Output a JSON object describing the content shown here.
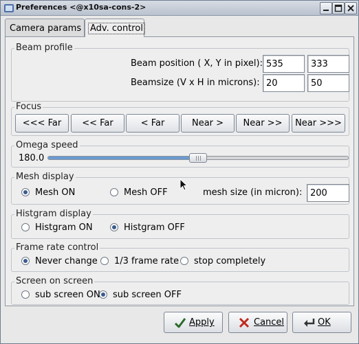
{
  "window": {
    "title": "Preferences <@x10sa-cons-2>"
  },
  "tabs": [
    {
      "label": "Camera params",
      "active": false
    },
    {
      "label": "Adv. control",
      "active": true
    }
  ],
  "beam_profile": {
    "title": "Beam profile",
    "position_label": "Beam position ( X, Y in pixel):",
    "position_x": "535",
    "position_y": "333",
    "size_label": "Beamsize (V x H in microns):",
    "size_v": "20",
    "size_h": "50"
  },
  "focus": {
    "title": "Focus",
    "buttons": [
      "<<< Far",
      "<< Far",
      "< Far",
      "Near >",
      "Near >>",
      "Near >>>"
    ]
  },
  "omega_speed": {
    "title": "Omega speed",
    "value_text": "180.0",
    "slider_fraction": 0.5
  },
  "mesh_display": {
    "title": "Mesh display",
    "on_label": "Mesh ON",
    "off_label": "Mesh OFF",
    "selected": "on",
    "size_label": "mesh size (in micron):",
    "size_value": "200"
  },
  "histogram_display": {
    "title": "Histgram display",
    "on_label": "Histgram ON",
    "off_label": "Histgram OFF",
    "selected": "off"
  },
  "frame_rate": {
    "title": "Frame rate control",
    "options": [
      "Never change",
      "1/3 frame rate",
      "stop completely"
    ],
    "selected": 0
  },
  "screen_on_screen": {
    "title": "Screen on screen",
    "on_label": "sub screen ON",
    "off_label": "sub screen OFF",
    "selected": "off"
  },
  "dialog_buttons": {
    "apply": "Apply",
    "cancel": "Cancel",
    "ok": "OK"
  },
  "colors": {
    "accent": "#6a9bd1",
    "radio_dot": "#3a5b8f",
    "cancel_x": "#c0281c",
    "check": "#2b6a2b"
  },
  "icons": [
    "app-icon",
    "minimize-icon",
    "maximize-icon",
    "close-icon",
    "apply-check-icon",
    "cancel-x-icon",
    "ok-arrow-icon",
    "mouse-pointer-icon"
  ]
}
